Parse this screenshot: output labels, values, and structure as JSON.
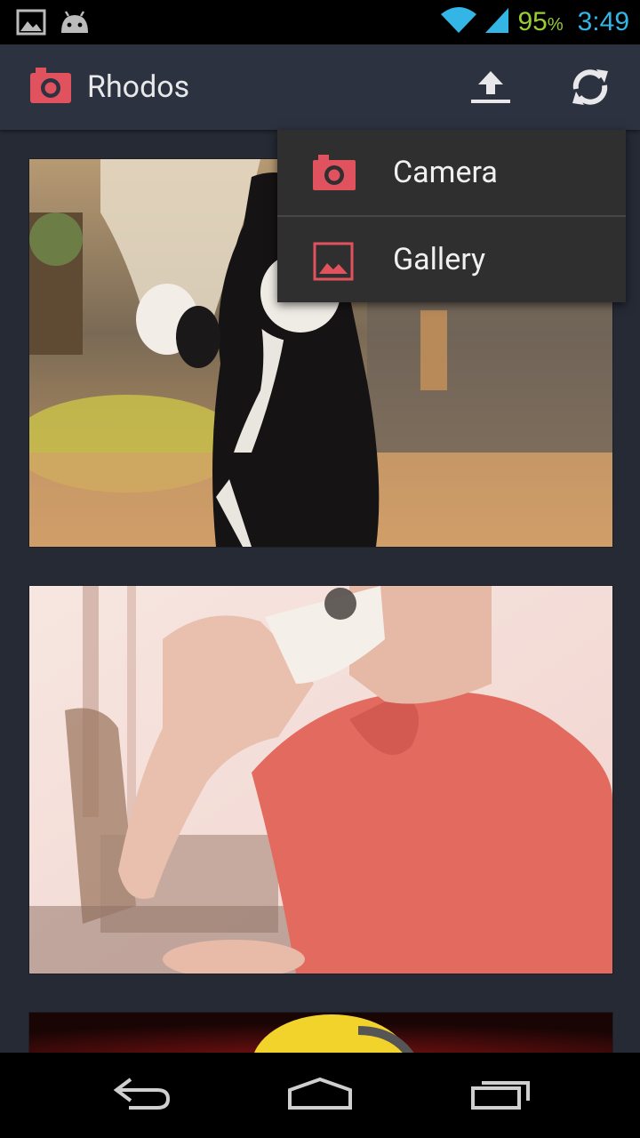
{
  "status_bar": {
    "battery_percent": "95",
    "battery_unit": "%",
    "time": "3:49",
    "icons": [
      "gallery-notification-icon",
      "android-debug-icon",
      "wifi-icon",
      "signal-icon"
    ]
  },
  "action_bar": {
    "title": "Rhodos",
    "app_icon": "camera-icon",
    "actions": [
      "upload-icon",
      "refresh-icon"
    ]
  },
  "menu": {
    "items": [
      {
        "label": "Camera",
        "icon": "camera-icon"
      },
      {
        "label": "Gallery",
        "icon": "image-icon"
      }
    ]
  },
  "feed": {
    "photos": [
      {
        "subject": "cat-photo"
      },
      {
        "subject": "coffee-photo"
      },
      {
        "subject": "minion-photo"
      }
    ]
  },
  "nav_bar": {
    "buttons": [
      "back-icon",
      "home-icon",
      "recent-apps-icon"
    ]
  },
  "colors": {
    "accent": "#e0525e",
    "action_bar": "#2d3241",
    "background": "#252a35",
    "clock": "#33b5e5",
    "battery": "#9acd32"
  }
}
